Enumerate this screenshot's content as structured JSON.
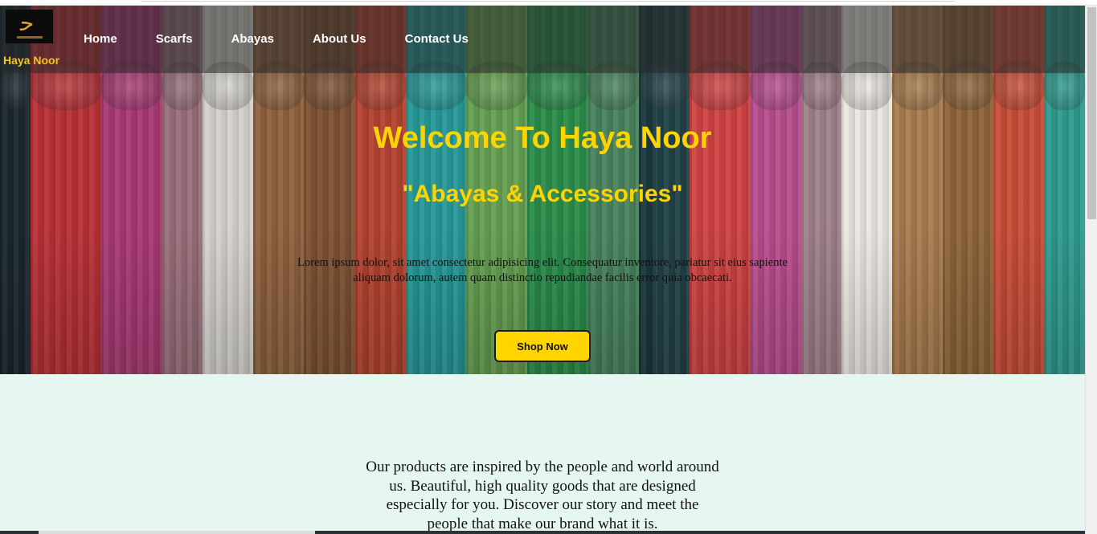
{
  "brand": {
    "name": "Haya Noor",
    "logo_icon": "calligraphy-logo-icon",
    "logo_glyph": "ﺣ"
  },
  "nav": {
    "items": [
      {
        "label": "Home"
      },
      {
        "label": "Scarfs"
      },
      {
        "label": "Abayas"
      },
      {
        "label": "About Us"
      },
      {
        "label": "Contact Us"
      }
    ]
  },
  "hero": {
    "title": "Welcome To Haya Noor",
    "subtitle": "\"Abayas & Accessories\"",
    "paragraph": "Lorem ipsum dolor, sit amet consectetur adipisicing elit. Consequatur inventore, pariatur sit eius sapiente aliquam dolorum, autem quam distinctio repudiandae facilis error quia obcaecati.",
    "cta_label": "Shop Now",
    "scarf_colors": [
      "#1e2a33",
      "#c9363d",
      "#b8407f",
      "#a67a86",
      "#e9e6df",
      "#9c6b45",
      "#8a5a38",
      "#c54a35",
      "#2aa7a6",
      "#6fae5a",
      "#2f9a52",
      "#4f8f67",
      "#1e3f45",
      "#cf3f3f",
      "#b84a8c",
      "#9e7f89",
      "#ebe8e2",
      "#a87a4c",
      "#8c6237",
      "#c84a34",
      "#2b9a8c"
    ],
    "scarf_widths": [
      3,
      7,
      6,
      4,
      5,
      5,
      5,
      5,
      6,
      6,
      6,
      5,
      5,
      6,
      5,
      4,
      5,
      5,
      5,
      5,
      4
    ]
  },
  "about": {
    "text": "Our products are inspired by the people and world around us. Beautiful, high quality goods that are designed especially for you. Discover our story and meet the people that make our brand what it is."
  },
  "colors": {
    "accent": "#ffd400",
    "about_bg": "#e6f7f1",
    "nav_overlay": "rgba(40,40,40,0.55)"
  }
}
